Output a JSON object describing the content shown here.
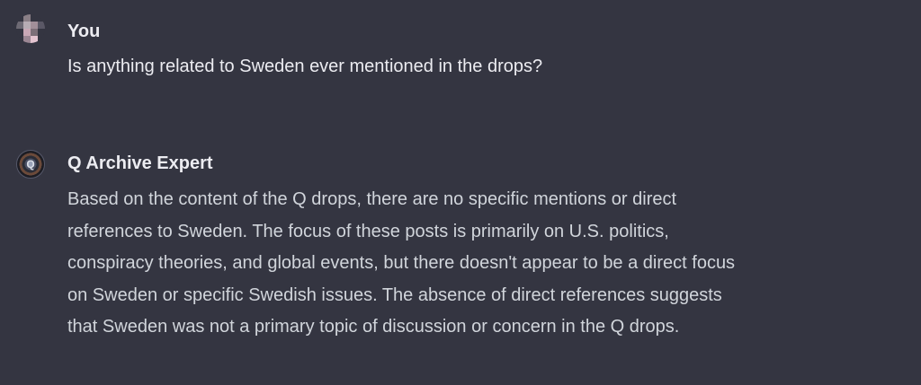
{
  "conversation": {
    "user_message": {
      "author": "You",
      "avatar_icon": "pixelated-avatar-icon",
      "text": "Is anything related to Sweden ever mentioned in the drops?"
    },
    "assistant_message": {
      "author": "Q Archive Expert",
      "avatar_icon": "q-emblem-avatar-icon",
      "lines": [
        "Based on the content of the Q drops, there are no specific mentions or direct",
        "references to Sweden. The focus of these posts is primarily on U.S. politics,",
        "conspiracy theories, and global events, but there doesn't appear to be a direct focus",
        "on Sweden or specific Swedish issues. The absence of direct references suggests",
        "that Sweden was not a primary topic of discussion or concern in the Q drops."
      ]
    }
  },
  "colors": {
    "background": "#343541",
    "author_text": "#ececf1",
    "body_text": "#d1d5db"
  }
}
